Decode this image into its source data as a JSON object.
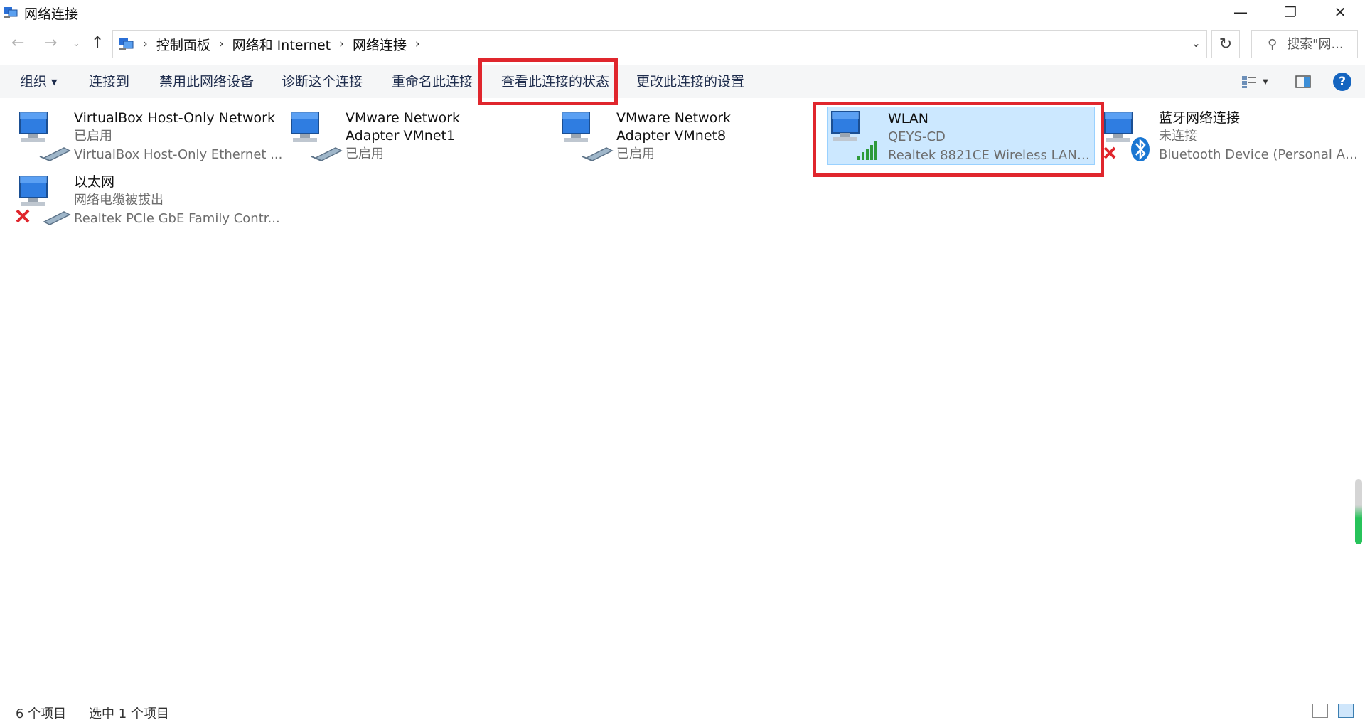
{
  "window": {
    "title": "网络连接"
  },
  "address_bar": {
    "breadcrumbs": [
      "控制面板",
      "网络和 Internet",
      "网络连接"
    ],
    "search_placeholder": "搜索\"网..."
  },
  "command_bar": {
    "organize": "组织",
    "connect_to": "连接到",
    "disable": "禁用此网络设备",
    "diagnose": "诊断这个连接",
    "rename": "重命名此连接",
    "view_status": "查看此连接的状态",
    "change_settings": "更改此连接的设置",
    "help": "?"
  },
  "connections": [
    {
      "name": "VirtualBox Host-Only Network",
      "status": "已启用",
      "device": "VirtualBox Host-Only Ethernet ..."
    },
    {
      "name": "VMware Network Adapter VMnet1",
      "status": "已启用",
      "device": ""
    },
    {
      "name": "VMware Network Adapter VMnet8",
      "status": "已启用",
      "device": ""
    },
    {
      "name": "WLAN",
      "status": "QEYS-CD",
      "device": "Realtek 8821CE Wireless LAN ..."
    },
    {
      "name": "蓝牙网络连接",
      "status": "未连接",
      "device": "Bluetooth Device (Personal Are..."
    },
    {
      "name": "以太网",
      "status": "网络电缆被拔出",
      "device": "Realtek PCIe GbE Family Contr..."
    }
  ],
  "status_bar": {
    "item_count": "6 个项目",
    "selected_count": "选中 1 个项目"
  },
  "colors": {
    "highlight": "#e0262d",
    "selection": "#cce8ff",
    "command_text": "#1f2d4d"
  }
}
